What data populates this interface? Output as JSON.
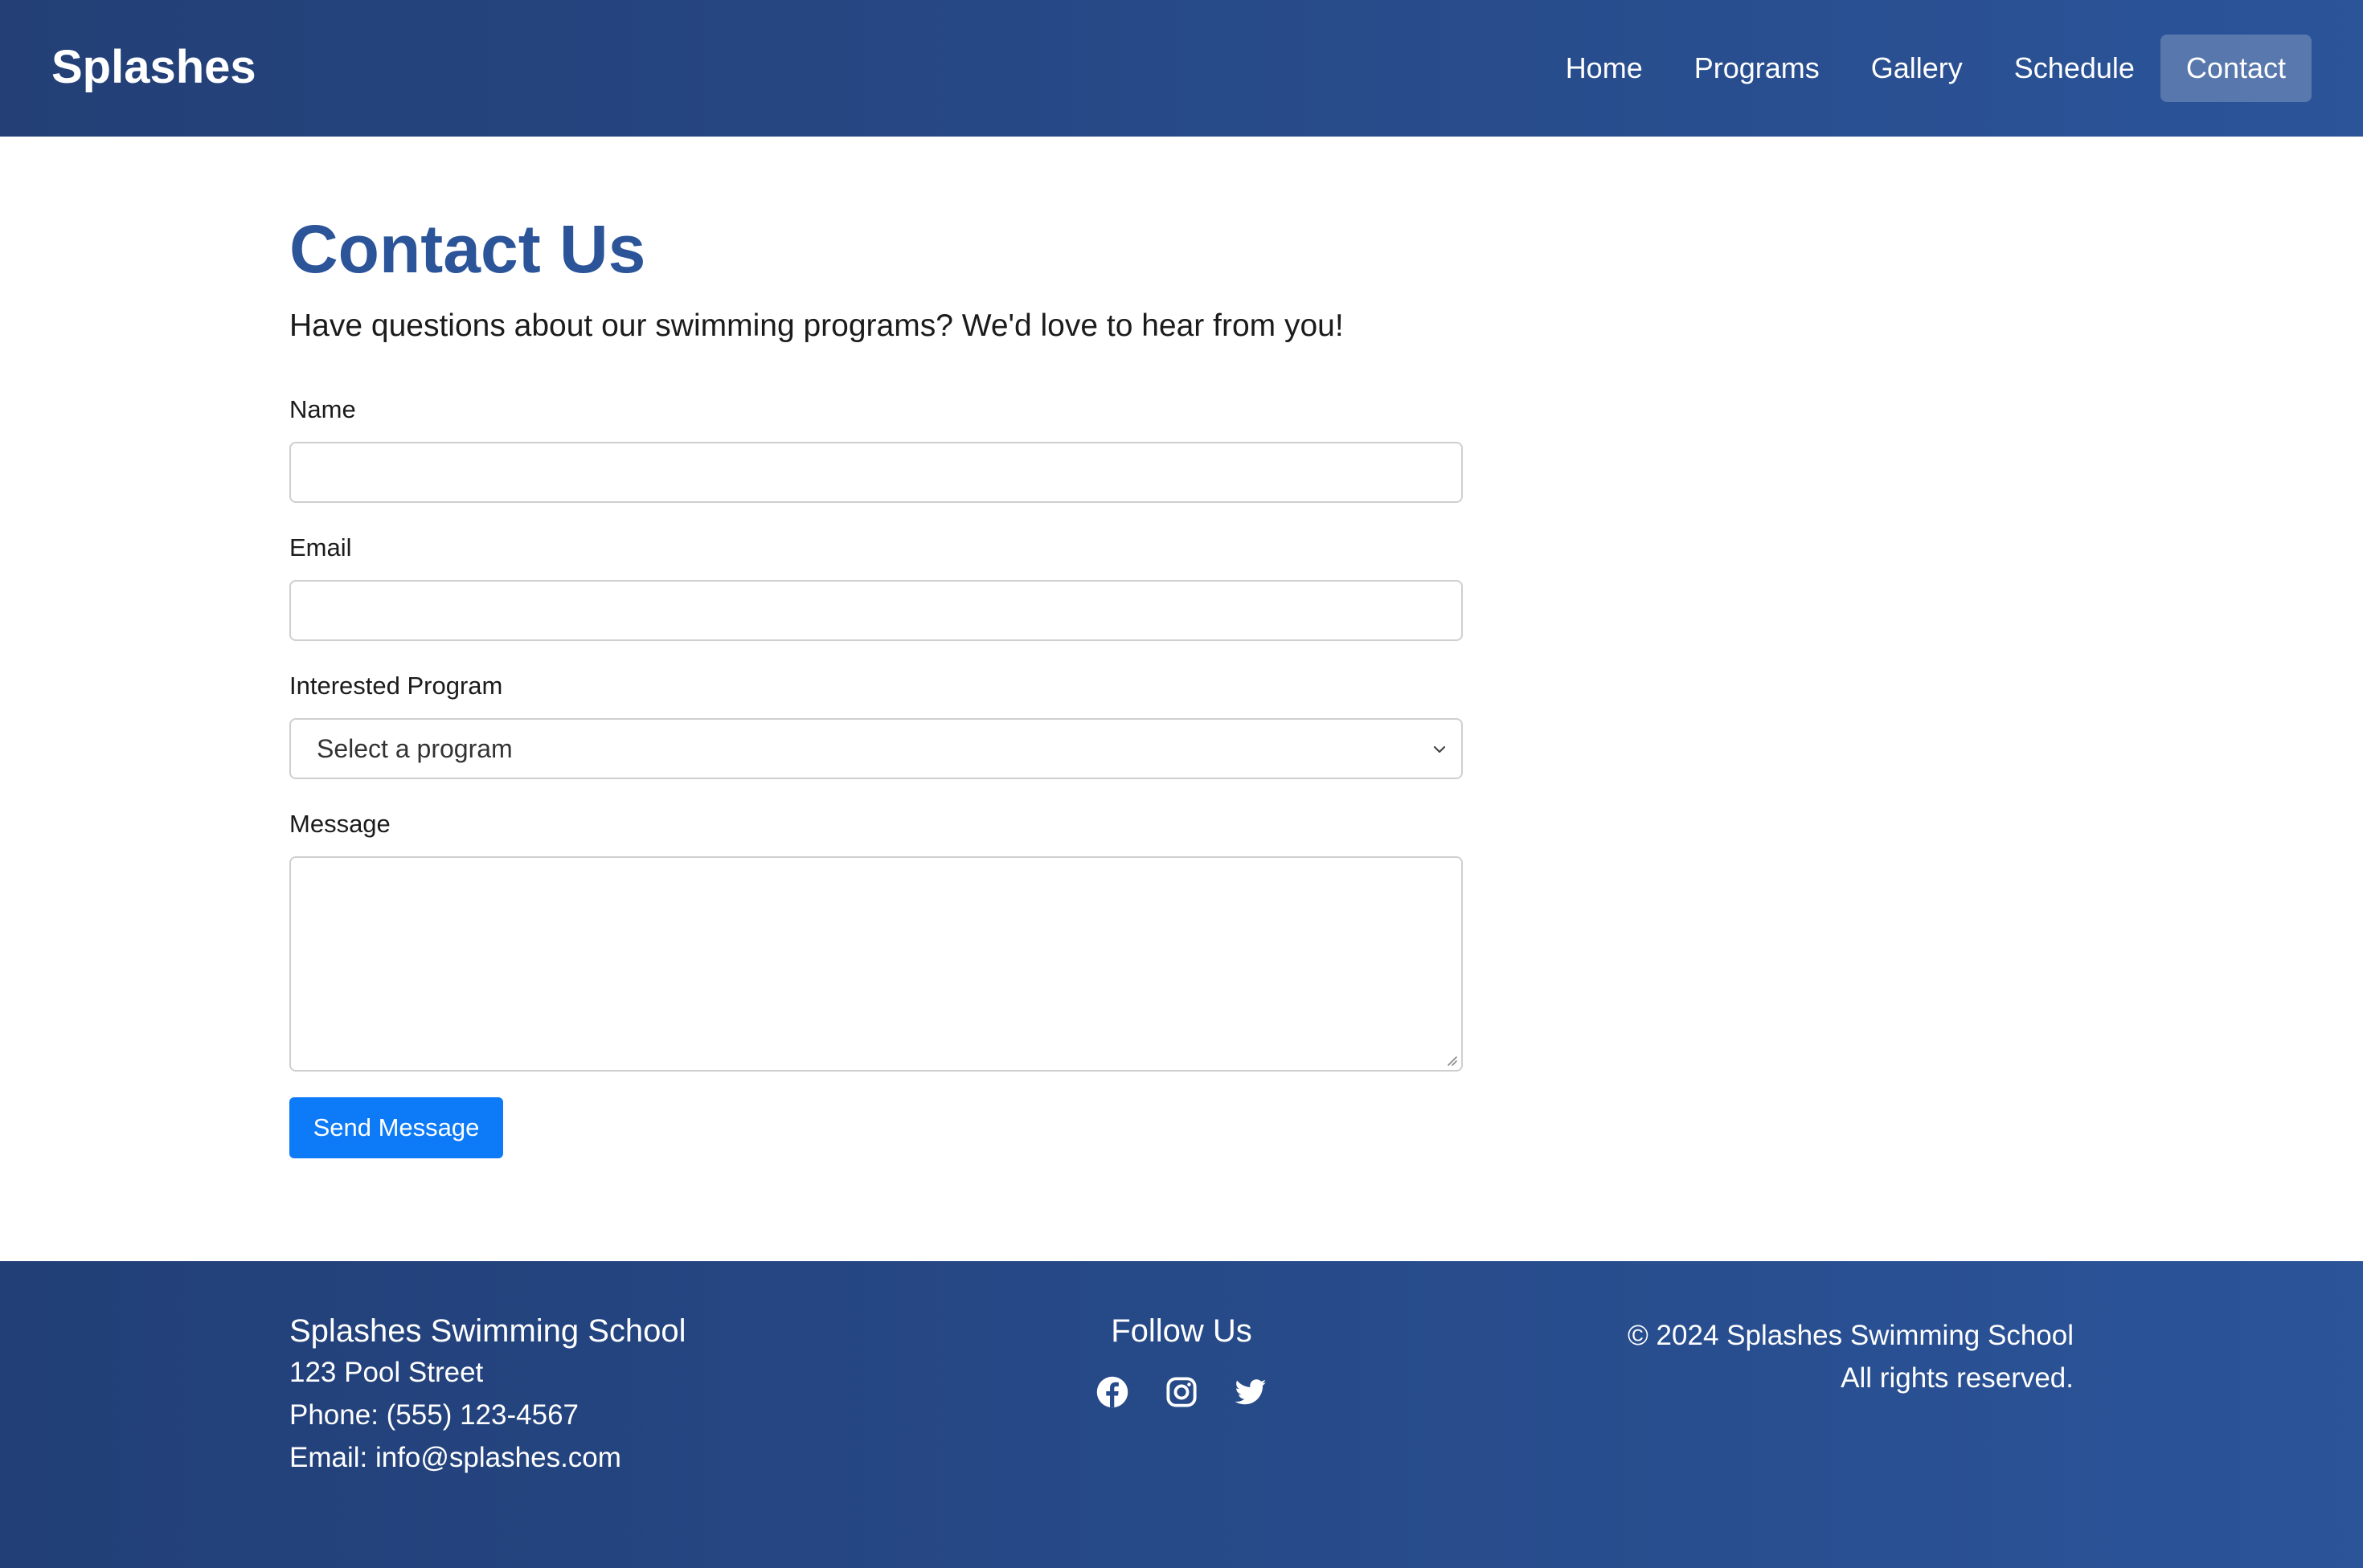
{
  "header": {
    "logo": "Splashes",
    "nav": [
      {
        "label": "Home",
        "active": false
      },
      {
        "label": "Programs",
        "active": false
      },
      {
        "label": "Gallery",
        "active": false
      },
      {
        "label": "Schedule",
        "active": false
      },
      {
        "label": "Contact",
        "active": true
      }
    ]
  },
  "main": {
    "title": "Contact Us",
    "subtitle": "Have questions about our swimming programs? We'd love to hear from you!",
    "form": {
      "name_label": "Name",
      "name_value": "",
      "email_label": "Email",
      "email_value": "",
      "program_label": "Interested Program",
      "program_selected": "Select a program",
      "message_label": "Message",
      "message_value": "",
      "submit_label": "Send Message"
    }
  },
  "footer": {
    "school_name": "Splashes Swimming School",
    "address": "123 Pool Street",
    "phone": "Phone: (555) 123-4567",
    "email": "Email: info@splashes.com",
    "follow_title": "Follow Us",
    "social_icons": [
      "facebook-icon",
      "instagram-icon",
      "twitter-icon"
    ],
    "copyright": "© 2024 Splashes Swimming School",
    "rights": "All rights reserved."
  },
  "colors": {
    "header_bg": "#233f76",
    "accent_title": "#2b5499",
    "button": "#0d7bf7"
  }
}
